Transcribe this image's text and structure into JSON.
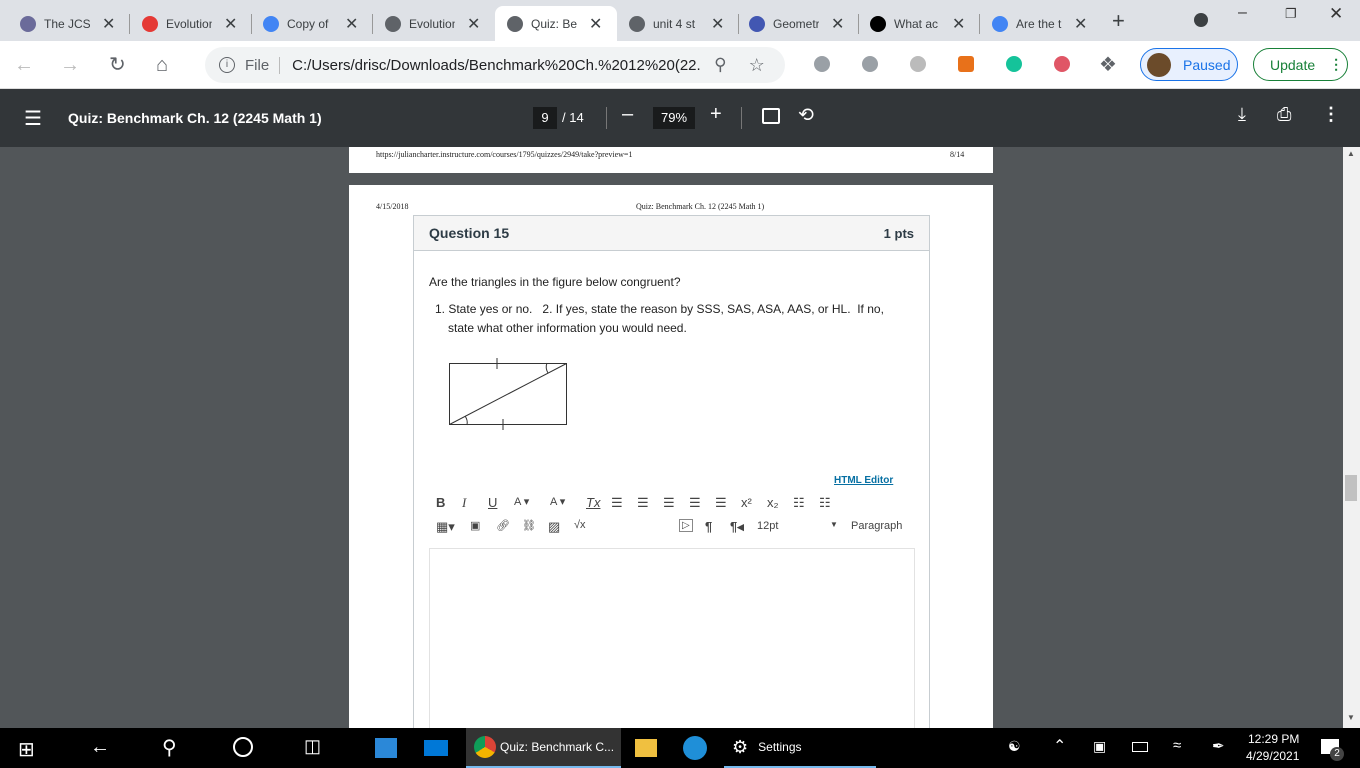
{
  "tabs": [
    {
      "label": "The JCS",
      "icon": "gear-logo-icon",
      "color": "#6b6b9a"
    },
    {
      "label": "Evolution",
      "icon": "ring-icon",
      "color": "#e53935"
    },
    {
      "label": "Copy of",
      "icon": "docs-icon",
      "color": "#4285f4"
    },
    {
      "label": "Evolution",
      "icon": "globe-icon",
      "color": "#5f6368"
    },
    {
      "label": "Quiz: Be",
      "icon": "globe-icon",
      "color": "#5f6368"
    },
    {
      "label": "unit 4 st",
      "icon": "globe-icon",
      "color": "#5f6368"
    },
    {
      "label": "Geometr",
      "icon": "quizlet-icon",
      "color": "#4257b2"
    },
    {
      "label": "What ac",
      "icon": "brainly-icon",
      "color": "#000000"
    },
    {
      "label": "Are the t",
      "icon": "google-icon",
      "color": "#4285f4"
    }
  ],
  "omnibox": {
    "scheme": "File",
    "url": "C:/Users/drisc/Downloads/Benchmark%20Ch.%2012%20(22..."
  },
  "profile": {
    "label": "Paused"
  },
  "update": {
    "label": "Update"
  },
  "pdf": {
    "title": "Quiz: Benchmark Ch. 12 (2245 Math 1)",
    "page": "9",
    "total": "/ 14",
    "zoom": "79%"
  },
  "page1": {
    "url": "https://juliancharter.instructure.com/courses/1795/quizzes/2949/take?preview=1",
    "pagenum": "8/14"
  },
  "page2": {
    "date": "4/15/2018",
    "header": "Quiz: Benchmark Ch. 12 (2245 Math 1)"
  },
  "question": {
    "title": "Question 15",
    "points": "1 pts",
    "prompt": "Are the triangles in the figure below congruent?",
    "instructions_1": "1. State yes or no.   2. If yes, state the reason by SSS, SAS, ASA, AAS, or HL.  If no,",
    "instructions_2": "state what other information you would need.",
    "html_editor": "HTML Editor"
  },
  "editor": {
    "font_size": "12pt",
    "block": "Paragraph"
  },
  "taskbar": {
    "chrome_label": "Quiz: Benchmark C...",
    "settings_label": "Settings",
    "time": "12:29 PM",
    "date": "4/29/2021",
    "notifications": "2"
  }
}
